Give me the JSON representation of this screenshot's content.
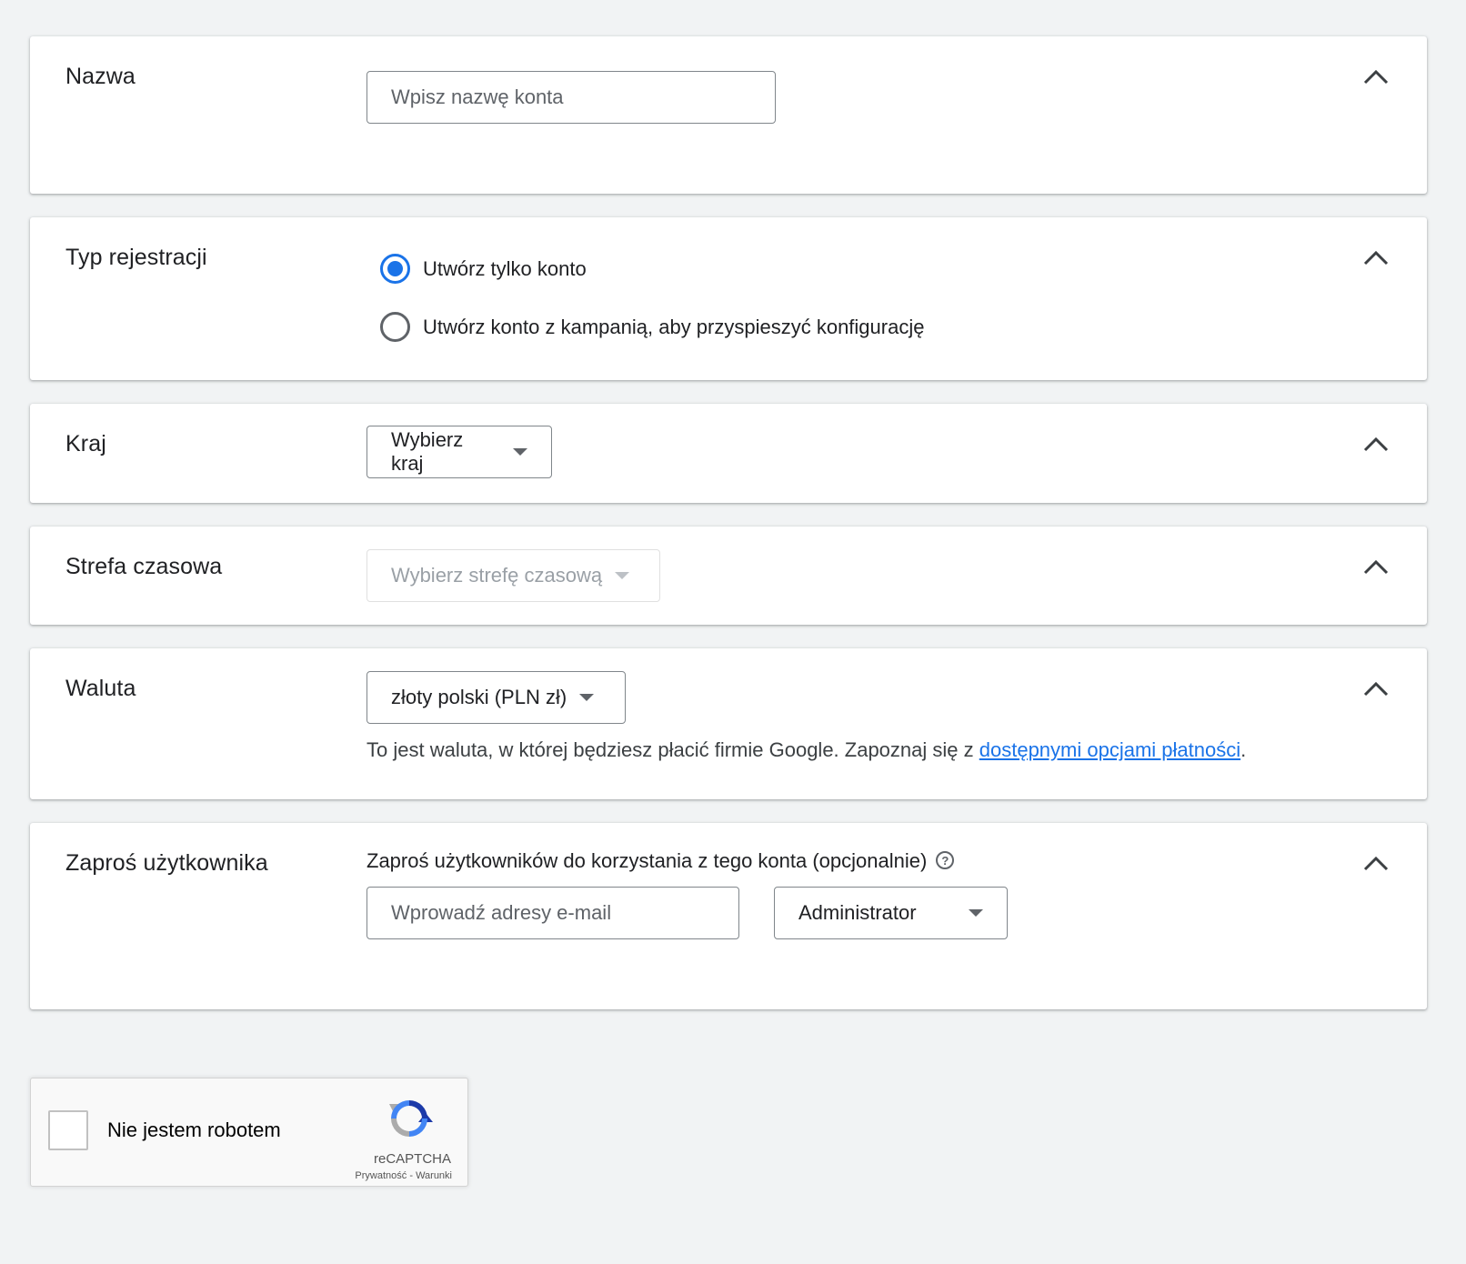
{
  "sections": {
    "name": {
      "title": "Nazwa",
      "input_placeholder": "Wpisz nazwę konta"
    },
    "registration_type": {
      "title": "Typ rejestracji",
      "options": [
        {
          "label": "Utwórz tylko konto",
          "selected": true
        },
        {
          "label": "Utwórz konto z kampanią, aby przyspieszyć konfigurację",
          "selected": false
        }
      ]
    },
    "country": {
      "title": "Kraj",
      "select_value": "Wybierz kraj"
    },
    "timezone": {
      "title": "Strefa czasowa",
      "select_value": "Wybierz strefę czasową",
      "disabled": true
    },
    "currency": {
      "title": "Waluta",
      "select_value": "złoty polski (PLN zł)",
      "helper_text": "To jest waluta, w której będziesz płacić firmie Google. Zapoznaj się z ",
      "helper_link": "dostępnymi opcjami płatności",
      "helper_suffix": "."
    },
    "invite": {
      "title": "Zaproś użytkownika",
      "description": "Zaproś użytkowników do korzystania z tego konta (opcjonalnie)",
      "help_symbol": "?",
      "email_placeholder": "Wprowadź adresy e-mail",
      "role_value": "Administrator"
    }
  },
  "captcha": {
    "label": "Nie jestem robotem",
    "brand": "reCAPTCHA",
    "privacy": "Prywatność",
    "separator": " - ",
    "terms": "Warunki"
  },
  "icons": {
    "collapse": "chevron-up-icon",
    "help": "help-circle-icon",
    "recaptcha": "recaptcha-logo-icon"
  },
  "colors": {
    "accent": "#1a73e8",
    "background": "#f1f3f4",
    "text": "#202124"
  }
}
